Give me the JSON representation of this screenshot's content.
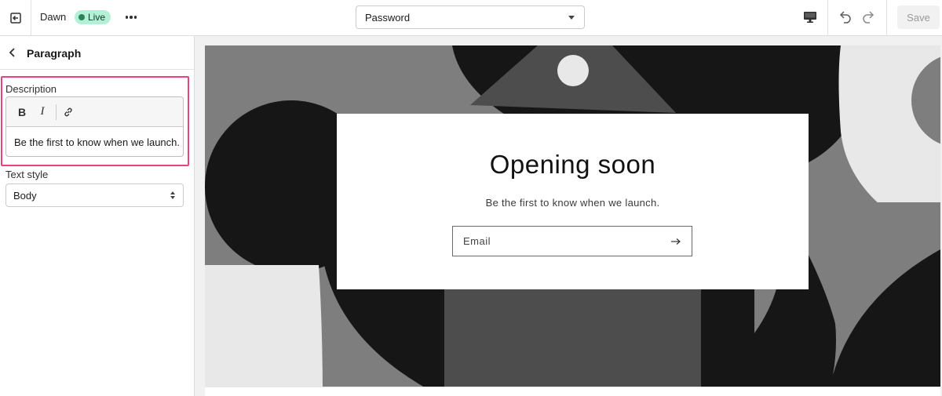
{
  "topbar": {
    "theme_name": "Dawn",
    "status_badge": "Live",
    "template_select_value": "Password",
    "save_label": "Save"
  },
  "sidebar": {
    "title": "Paragraph",
    "description_label": "Description",
    "toolbar": {
      "bold": "B",
      "italic": "I"
    },
    "description_text": "Be the first to know when we launch.",
    "text_style_label": "Text style",
    "text_style_value": "Body"
  },
  "preview": {
    "title": "Opening soon",
    "subtitle": "Be the first to know when we launch.",
    "email_placeholder": "Email"
  },
  "colors": {
    "highlight": "#e6457b",
    "live_badge_bg": "#b4f0d5",
    "live_dot": "#29845a"
  },
  "icons": [
    "exit-icon",
    "more-icon",
    "chevron-down-icon",
    "desktop-icon",
    "undo-icon",
    "redo-icon",
    "back-arrow-icon",
    "link-icon",
    "sort-icon",
    "arrow-right-icon"
  ]
}
